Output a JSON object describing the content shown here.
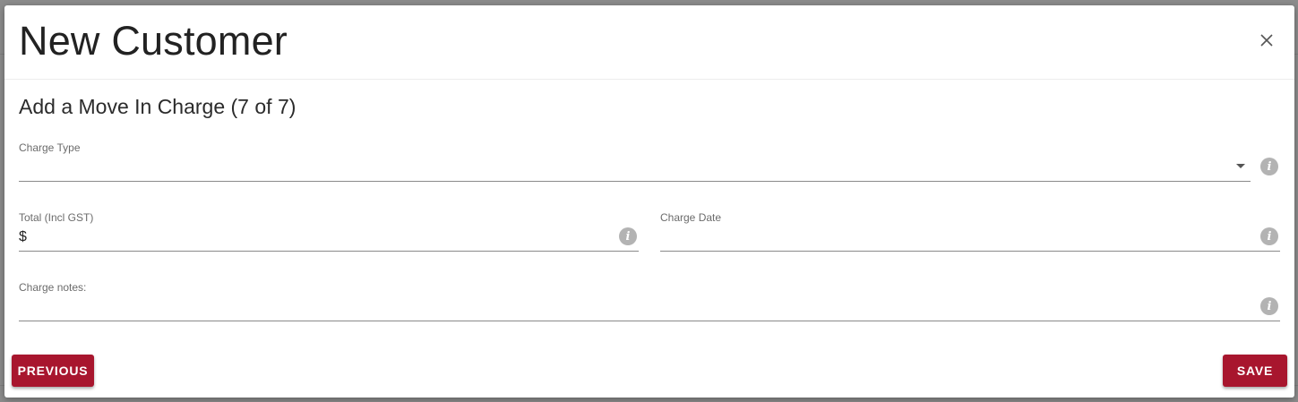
{
  "dialog": {
    "title": "New Customer",
    "step_title": "Add a Move In Charge (7 of 7)"
  },
  "form": {
    "charge_type": {
      "label": "Charge Type",
      "value": ""
    },
    "total": {
      "label": "Total (Incl GST)",
      "prefix": "$",
      "value": ""
    },
    "charge_date": {
      "label": "Charge Date",
      "value": ""
    },
    "charge_notes": {
      "label": "Charge notes:",
      "value": ""
    }
  },
  "buttons": {
    "previous": "PREVIOUS",
    "save": "SAVE"
  },
  "icons": {
    "close": "close-icon",
    "info": "info-icon",
    "dropdown": "dropdown-arrow-icon"
  },
  "colors": {
    "accent": "#a8162e",
    "info_icon": "#b3b3b3"
  }
}
